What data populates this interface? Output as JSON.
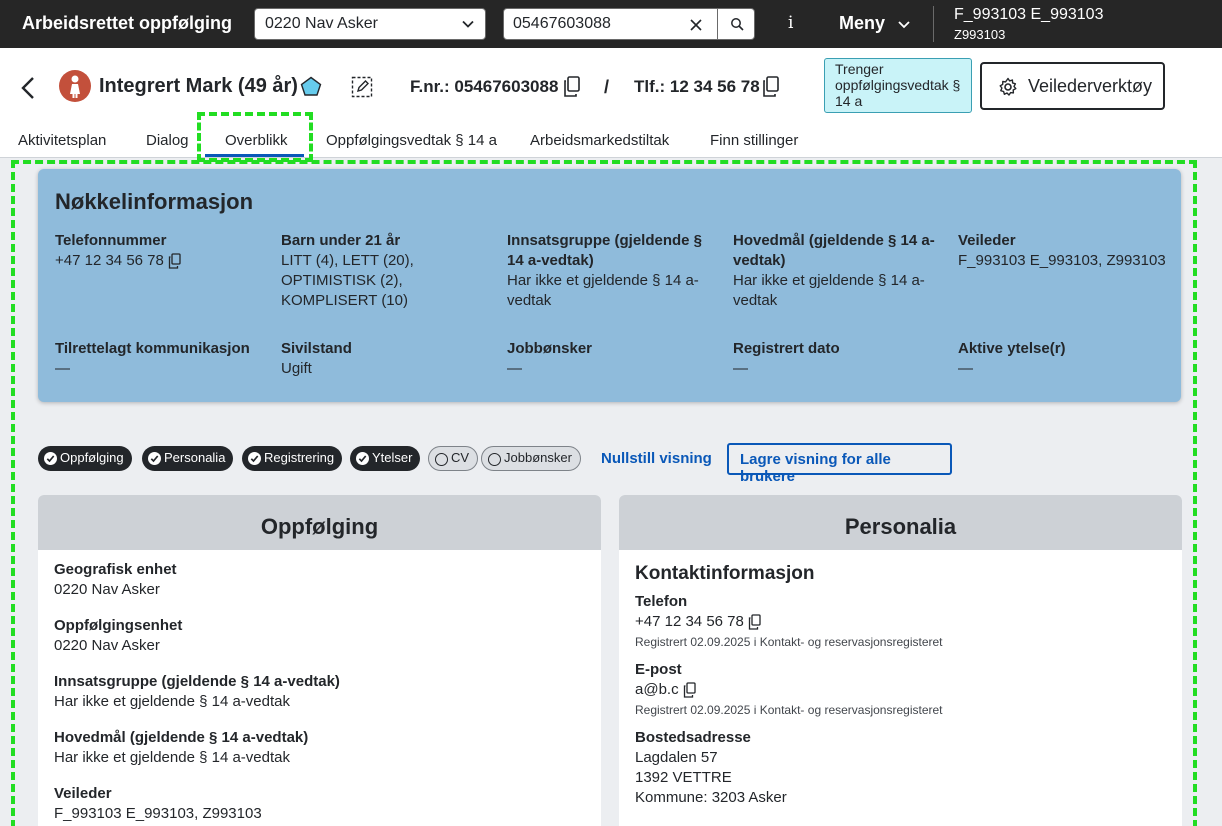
{
  "topbar": {
    "app_title": "Arbeidsrettet oppfølging",
    "enhet_value": "0220 Nav Asker",
    "search_value": "05467603088",
    "info_label": "i",
    "meny_label": "Meny",
    "user_name": "F_993103 E_993103",
    "user_ident": "Z993103"
  },
  "person": {
    "name": "Integrert Mark (49 år)",
    "fnr": "F.nr.: 05467603088",
    "separator": "/",
    "tlf": "Tlf.: 12 34 56 78",
    "vedtak_badge": "Trenger oppfølgingsvedtak § 14 a",
    "veileder_button": "Veilederverktøy"
  },
  "tabs": [
    "Aktivitetsplan",
    "Dialog",
    "Overblikk",
    "Oppfølgingsvedtak § 14 a",
    "Arbeidsmarkedstiltak",
    "Finn stillinger"
  ],
  "noekkel": {
    "title": "Nøkkelinformasjon",
    "items": [
      {
        "label": "Telefonnummer",
        "value": "+47 12 34 56 78"
      },
      {
        "label": "Barn under 21 år",
        "value": "LITT (4), LETT (20), OPTIMISTISK (2), KOMPLISERT (10)"
      },
      {
        "label": "Innsatsgruppe (gjeldende § 14 a-vedtak)",
        "value": "Har ikke et gjeldende § 14 a-vedtak"
      },
      {
        "label": "Hovedmål (gjeldende § 14 a-vedtak)",
        "value": "Har ikke et gjeldende § 14 a-vedtak"
      },
      {
        "label": "Veileder",
        "value": "F_993103 E_993103, Z993103"
      },
      {
        "label": "Tilrettelagt kommunikasjon",
        "value": "—"
      },
      {
        "label": "Sivilstand",
        "value": "Ugift"
      },
      {
        "label": "Jobbønsker",
        "value": "—"
      },
      {
        "label": "Registrert dato",
        "value": "—"
      },
      {
        "label": "Aktive ytelse(r)",
        "value": "—"
      }
    ]
  },
  "chips": [
    {
      "label": "Oppfølging",
      "selected": true
    },
    {
      "label": "Personalia",
      "selected": true
    },
    {
      "label": "Registrering",
      "selected": true
    },
    {
      "label": "Ytelser",
      "selected": true
    },
    {
      "label": "CV",
      "selected": false
    },
    {
      "label": "Jobbønsker",
      "selected": false
    }
  ],
  "actions": {
    "nullstill": "Nullstill visning",
    "lagre": "Lagre visning for alle brukere"
  },
  "oppfolging": {
    "title": "Oppfølging",
    "fields": [
      {
        "label": "Geografisk enhet",
        "value": "0220 Nav Asker"
      },
      {
        "label": "Oppfølgingsenhet",
        "value": "0220 Nav Asker"
      },
      {
        "label": "Innsatsgruppe (gjeldende § 14 a-vedtak)",
        "value": "Har ikke et gjeldende § 14 a-vedtak"
      },
      {
        "label": "Hovedmål (gjeldende § 14 a-vedtak)",
        "value": "Har ikke et gjeldende § 14 a-vedtak"
      },
      {
        "label": "Veileder",
        "value": "F_993103 E_993103, Z993103"
      }
    ]
  },
  "personalia": {
    "title": "Personalia",
    "kontakt_heading": "Kontaktinformasjon",
    "telefon_label": "Telefon",
    "telefon_value": "+47 12 34 56 78",
    "telefon_note": "Registrert 02.09.2025 i Kontakt- og reservasjonsregisteret",
    "epost_label": "E-post",
    "epost_value": "a@b.c",
    "epost_note": "Registrert 02.09.2025 i Kontakt- og reservasjonsregisteret",
    "adresse_label": "Bostedsadresse",
    "adresse_line1": "Lagdalen 57",
    "adresse_line2": "1392 VETTRE",
    "adresse_line3": "Kommune: 3203 Asker"
  },
  "colors": {
    "accent": "#0a58b8",
    "topbar": "#262626",
    "noekkel_bg": "#8fbbdb",
    "highlight": "#22dd22",
    "vedtak_badge_bg": "#c9f3f8"
  }
}
